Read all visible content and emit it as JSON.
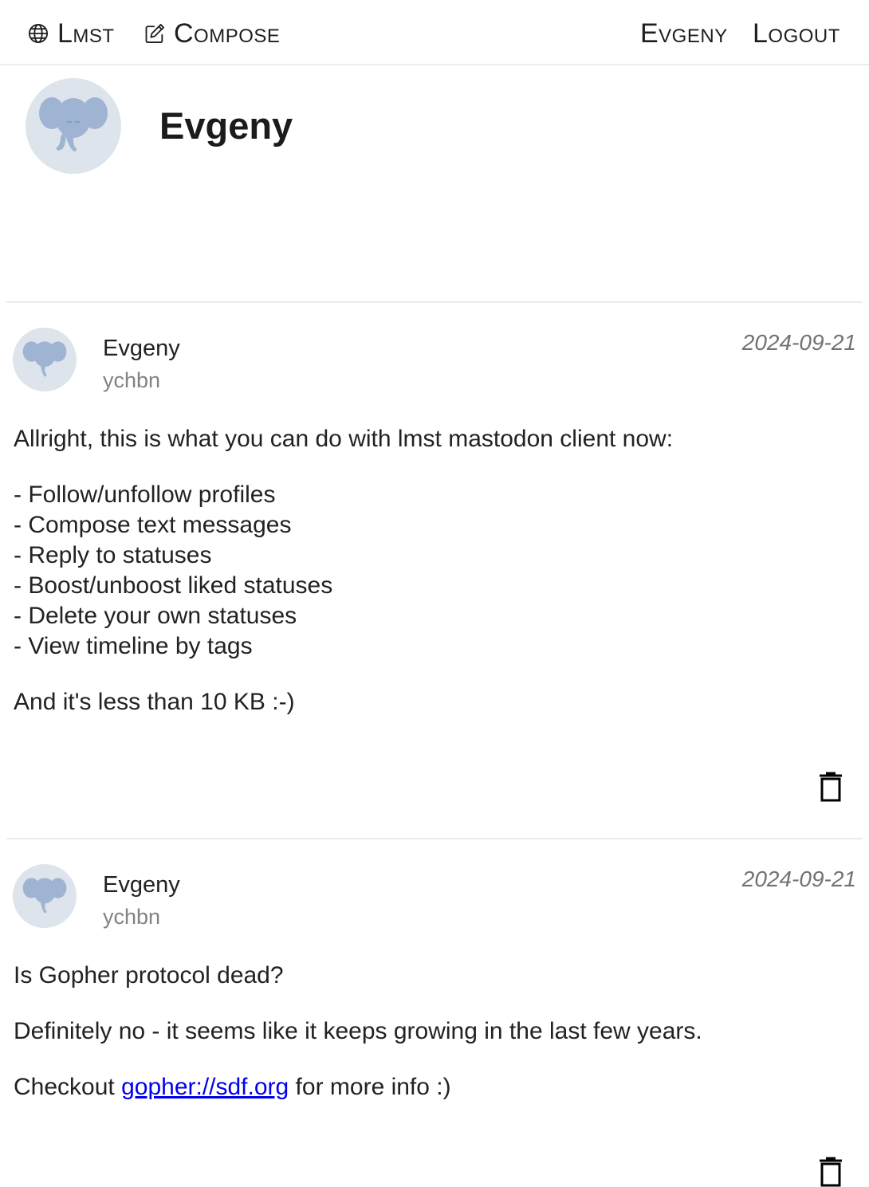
{
  "nav": {
    "brand": "Lmst",
    "compose": "Compose",
    "user": "Evgeny",
    "logout": "Logout"
  },
  "profile": {
    "name": "Evgeny"
  },
  "statuses": [
    {
      "name": "Evgeny",
      "handle": "ychbn",
      "date": "2024-09-21",
      "paragraphs": [
        "Allright, this is what you can do with lmst mastodon client now:",
        "- Follow/unfollow profiles\n- Compose text messages\n- Reply to statuses\n- Boost/unboost liked statuses\n- Delete your own statuses\n- View timeline by tags",
        "And it's less than 10 KB :-)"
      ]
    },
    {
      "name": "Evgeny",
      "handle": "ychbn",
      "date": "2024-09-21",
      "p1": "Is Gopher protocol dead?",
      "p2": "Definitely no - it seems like it keeps growing in the last few years.",
      "p3_before": "Checkout ",
      "p3_link": "gopher://sdf.org",
      "p3_after": " for more info :)"
    }
  ],
  "icons": {
    "brand": "globe-icon",
    "compose": "pencil-square-icon",
    "delete": "trash-icon",
    "avatar": "elephant-avatar"
  },
  "colors": {
    "avatar_bg": "#dde4ec",
    "avatar_fg": "#9fb4d3",
    "link": "#0000ee",
    "date": "#727272"
  }
}
